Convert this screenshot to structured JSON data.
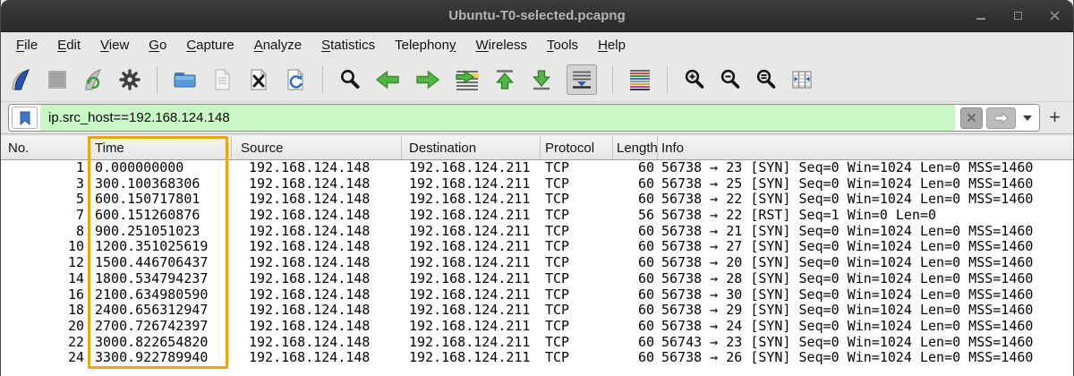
{
  "window": {
    "title": "Ubuntu-T0-selected.pcapng",
    "controls": [
      "minimize",
      "maximize",
      "close"
    ]
  },
  "menu": {
    "items": [
      {
        "label": "File",
        "u": 0
      },
      {
        "label": "Edit",
        "u": 0
      },
      {
        "label": "View",
        "u": 0
      },
      {
        "label": "Go",
        "u": 0
      },
      {
        "label": "Capture",
        "u": 0
      },
      {
        "label": "Analyze",
        "u": 0
      },
      {
        "label": "Statistics",
        "u": 0
      },
      {
        "label": "Telephony",
        "u": 8
      },
      {
        "label": "Wireless",
        "u": 0
      },
      {
        "label": "Tools",
        "u": 0
      },
      {
        "label": "Help",
        "u": 0
      }
    ]
  },
  "toolbar": {
    "buttons": [
      "start-capture-icon",
      "stop-capture-icon",
      "restart-capture-icon",
      "capture-options-icon",
      "open-file-icon",
      "save-file-icon",
      "close-file-icon",
      "reload-file-icon",
      "find-packet-icon",
      "go-back-icon",
      "go-forward-icon",
      "go-to-packet-icon",
      "go-first-packet-icon",
      "go-last-packet-icon",
      "auto-scroll-icon",
      "colorize-icon",
      "zoom-in-icon",
      "zoom-out-icon",
      "zoom-reset-icon",
      "resize-columns-icon"
    ],
    "pressed": "auto-scroll-icon"
  },
  "filter": {
    "value": "ip.src_host==192.168.124.148",
    "valid_bg": "#c9f7c5",
    "add_label": "+"
  },
  "packet_list": {
    "columns": [
      {
        "key": "no",
        "label": "No."
      },
      {
        "key": "time",
        "label": "Time"
      },
      {
        "key": "source",
        "label": "Source"
      },
      {
        "key": "destination",
        "label": "Destination"
      },
      {
        "key": "protocol",
        "label": "Protocol"
      },
      {
        "key": "length",
        "label": "Length"
      },
      {
        "key": "info",
        "label": "Info"
      }
    ],
    "rows": [
      [
        "1",
        "0.000000000",
        "192.168.124.148",
        "192.168.124.211",
        "TCP",
        "60",
        "56738 → 23 [SYN] Seq=0 Win=1024 Len=0 MSS=1460"
      ],
      [
        "3",
        "300.100368306",
        "192.168.124.148",
        "192.168.124.211",
        "TCP",
        "60",
        "56738 → 25 [SYN] Seq=0 Win=1024 Len=0 MSS=1460"
      ],
      [
        "5",
        "600.150717801",
        "192.168.124.148",
        "192.168.124.211",
        "TCP",
        "60",
        "56738 → 22 [SYN] Seq=0 Win=1024 Len=0 MSS=1460"
      ],
      [
        "7",
        "600.151260876",
        "192.168.124.148",
        "192.168.124.211",
        "TCP",
        "56",
        "56738 → 22 [RST] Seq=1 Win=0 Len=0"
      ],
      [
        "8",
        "900.251051023",
        "192.168.124.148",
        "192.168.124.211",
        "TCP",
        "60",
        "56738 → 21 [SYN] Seq=0 Win=1024 Len=0 MSS=1460"
      ],
      [
        "10",
        "1200.351025619",
        "192.168.124.148",
        "192.168.124.211",
        "TCP",
        "60",
        "56738 → 27 [SYN] Seq=0 Win=1024 Len=0 MSS=1460"
      ],
      [
        "12",
        "1500.446706437",
        "192.168.124.148",
        "192.168.124.211",
        "TCP",
        "60",
        "56738 → 20 [SYN] Seq=0 Win=1024 Len=0 MSS=1460"
      ],
      [
        "14",
        "1800.534794237",
        "192.168.124.148",
        "192.168.124.211",
        "TCP",
        "60",
        "56738 → 28 [SYN] Seq=0 Win=1024 Len=0 MSS=1460"
      ],
      [
        "16",
        "2100.634980590",
        "192.168.124.148",
        "192.168.124.211",
        "TCP",
        "60",
        "56738 → 30 [SYN] Seq=0 Win=1024 Len=0 MSS=1460"
      ],
      [
        "18",
        "2400.656312947",
        "192.168.124.148",
        "192.168.124.211",
        "TCP",
        "60",
        "56738 → 29 [SYN] Seq=0 Win=1024 Len=0 MSS=1460"
      ],
      [
        "20",
        "2700.726742397",
        "192.168.124.148",
        "192.168.124.211",
        "TCP",
        "60",
        "56738 → 24 [SYN] Seq=0 Win=1024 Len=0 MSS=1460"
      ],
      [
        "22",
        "3000.822654820",
        "192.168.124.148",
        "192.168.124.211",
        "TCP",
        "60",
        "56743 → 23 [SYN] Seq=0 Win=1024 Len=0 MSS=1460"
      ],
      [
        "24",
        "3300.922789940",
        "192.168.124.148",
        "192.168.124.211",
        "TCP",
        "60",
        "56738 → 26 [SYN] Seq=0 Win=1024 Len=0 MSS=1460"
      ]
    ]
  },
  "highlight": {
    "target_column": "Time",
    "color": "#e8a713"
  }
}
